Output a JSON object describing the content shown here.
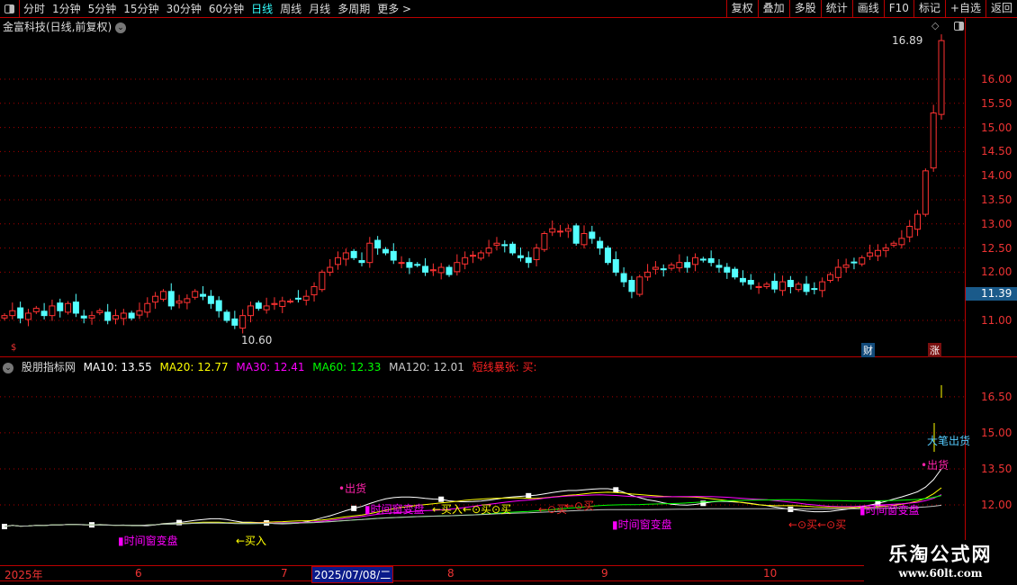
{
  "toolbar": {
    "periods": [
      "分时",
      "1分钟",
      "5分钟",
      "15分钟",
      "30分钟",
      "60分钟",
      "日线",
      "周线",
      "月线",
      "多周期",
      "更多 >"
    ],
    "active": "日线",
    "buttons": [
      "复权",
      "叠加",
      "多股",
      "统计",
      "画线",
      "F10",
      "标记",
      "+自选",
      "返回"
    ]
  },
  "chart_title": "金富科技(日线,前复权)",
  "main_axis": {
    "labels": [
      "16.00",
      "15.50",
      "15.00",
      "14.50",
      "14.00",
      "13.50",
      "13.00",
      "12.50",
      "12.00",
      "11.00"
    ],
    "current_price": "11.39",
    "high_label": "16.89",
    "low_label": "10.60"
  },
  "badges": {
    "cai": "财",
    "zhang": "涨",
    "left_marker": "$"
  },
  "indicator": {
    "name": "股朋指标网",
    "ma10": "MA10: 13.55",
    "ma20": "MA20: 12.77",
    "ma30": "MA30: 12.41",
    "ma60": "MA60: 12.33",
    "ma120": "MA120: 12.01",
    "signal": "短线暴张: 买:",
    "axis_labels": [
      "16.50",
      "15.00",
      "13.50",
      "12.00"
    ],
    "annotations": {
      "out1": "•出货",
      "window1": "▮时间窗变盘",
      "buy1": "←买入",
      "window2": "▮时间窗变盘",
      "buy2": "←买入←⊙买⊙买",
      "buy3": "←⊙买",
      "buy4": "←⊙买",
      "window3": "▮时间窗变盘",
      "buy5": "←⊙买←⊙买",
      "window4": "▮时间窗变盘",
      "bigout": "大笔出货",
      "out2": "•出货"
    }
  },
  "x_axis": {
    "labels": [
      "2025年",
      "6",
      "7",
      "8",
      "9",
      "10"
    ],
    "cursor_date": "2025/07/08/二"
  },
  "watermark": {
    "name": "乐淘公式网",
    "url": "www.60lt.com"
  },
  "colors": {
    "up": "#ff3232",
    "down": "#54ffff",
    "ma10": "#ffffff",
    "ma20": "#ffff00",
    "ma30": "#ff00ff",
    "ma60": "#00ff00",
    "ma120": "#c0c0c0",
    "grid": "#b00000"
  },
  "chart_data": {
    "type": "candlestick",
    "closes": [
      11.1,
      11.2,
      11.05,
      11.15,
      11.25,
      11.1,
      11.3,
      11.2,
      11.35,
      11.15,
      11.05,
      11.1,
      11.2,
      11.0,
      11.1,
      11.15,
      11.05,
      11.2,
      11.35,
      11.5,
      11.6,
      11.3,
      11.4,
      11.45,
      11.6,
      11.5,
      11.35,
      11.2,
      11.0,
      10.9,
      11.1,
      11.3,
      11.25,
      11.3,
      11.35,
      11.4,
      11.4,
      11.45,
      11.5,
      11.7,
      12.0,
      12.1,
      12.3,
      12.4,
      12.3,
      12.2,
      12.6,
      12.5,
      12.4,
      12.25,
      12.2,
      12.1,
      12.15,
      12.0,
      12.05,
      12.1,
      11.95,
      12.2,
      12.3,
      12.35,
      12.4,
      12.5,
      12.6,
      12.55,
      12.4,
      12.3,
      12.2,
      12.5,
      12.8,
      12.9,
      12.85,
      12.9,
      12.6,
      12.8,
      12.7,
      12.5,
      12.2,
      12.0,
      11.8,
      11.6,
      11.9,
      12.0,
      12.1,
      12.05,
      12.15,
      12.2,
      12.1,
      12.3,
      12.25,
      12.2,
      12.1,
      12.0,
      11.9,
      11.8,
      11.75,
      11.7,
      11.75,
      11.65,
      11.8,
      11.7,
      11.75,
      11.6,
      11.65,
      11.8,
      11.95,
      12.1,
      12.15,
      12.2,
      12.3,
      12.4,
      12.45,
      12.5,
      12.6,
      12.7,
      12.95,
      13.2,
      14.1,
      15.3,
      16.8
    ],
    "ylim_main": [
      10.6,
      16.89
    ]
  }
}
